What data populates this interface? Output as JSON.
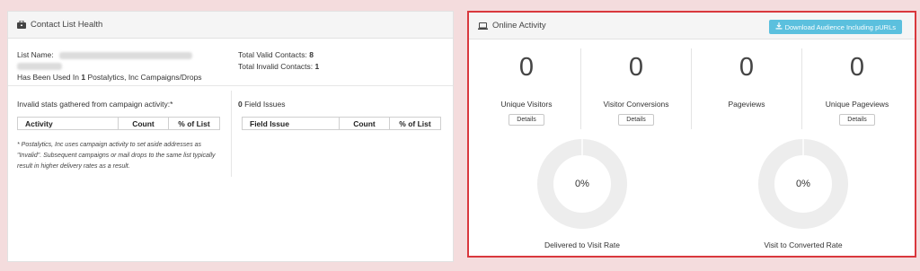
{
  "contact_health": {
    "title": "Contact List Health",
    "list_name_label": "List Name:",
    "used_in_prefix": "Has Been Used In",
    "used_in_count": "1",
    "used_in_suffix": "Postalytics, Inc Campaigns/Drops",
    "total_valid_label": "Total Valid Contacts:",
    "total_valid_value": "8",
    "total_invalid_label": "Total Invalid Contacts:",
    "total_invalid_value": "1",
    "invalid_stats_heading": "Invalid stats gathered from campaign activity:*",
    "activity_table": {
      "headers": [
        "Activity",
        "Count",
        "% of List"
      ]
    },
    "field_issues_count": "0",
    "field_issues_label": "Field Issues",
    "field_issue_table": {
      "headers": [
        "Field Issue",
        "Count",
        "% of List"
      ]
    },
    "footnote": "* Postalytics, Inc uses campaign activity to set aside addresses as \"Invalid\". Subsequent campaigns or mail drops to the same list typically result in higher delivery rates as a result."
  },
  "online_activity": {
    "title": "Online Activity",
    "download_button": "Download Audience Including pURLs",
    "stats": [
      {
        "value": "0",
        "label": "Unique Visitors",
        "button": "Details"
      },
      {
        "value": "0",
        "label": "Visitor Conversions",
        "button": "Details"
      },
      {
        "value": "0",
        "label": "Pageviews"
      },
      {
        "value": "0",
        "label": "Unique Pageviews",
        "button": "Details"
      }
    ],
    "rates": [
      {
        "percent": "0%",
        "label": "Delivered to Visit Rate"
      },
      {
        "percent": "0%",
        "label": "Visit to Converted Rate"
      }
    ]
  },
  "colors": {
    "page_bg": "#f4dcdd",
    "highlight_border": "#d9383d",
    "download_button": "#5bc0de",
    "donut_track": "#ededed"
  }
}
